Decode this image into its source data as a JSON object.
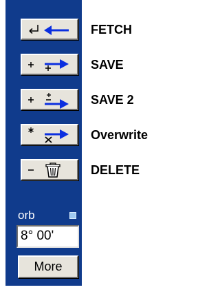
{
  "toolbar": {
    "actions": [
      {
        "key": "fetch",
        "label": "FETCH",
        "icon": "return-arrow-left-icon"
      },
      {
        "key": "save",
        "label": "SAVE",
        "icon": "plus-arrow-right-icon"
      },
      {
        "key": "save2",
        "label": "SAVE 2",
        "icon": "plus-plus-arrow-right-icon"
      },
      {
        "key": "overwrite",
        "label": "Overwrite",
        "icon": "asterisk-x-arrow-right-icon"
      },
      {
        "key": "delete",
        "label": "DELETE",
        "icon": "minus-trash-icon"
      }
    ]
  },
  "orb": {
    "label": "orb",
    "value": "8° 00'",
    "checked": true
  },
  "more_label": "More",
  "colors": {
    "panel": "#103b8c",
    "button_face": "#e7e4dc",
    "arrow_blue": "#0b2fe0"
  }
}
